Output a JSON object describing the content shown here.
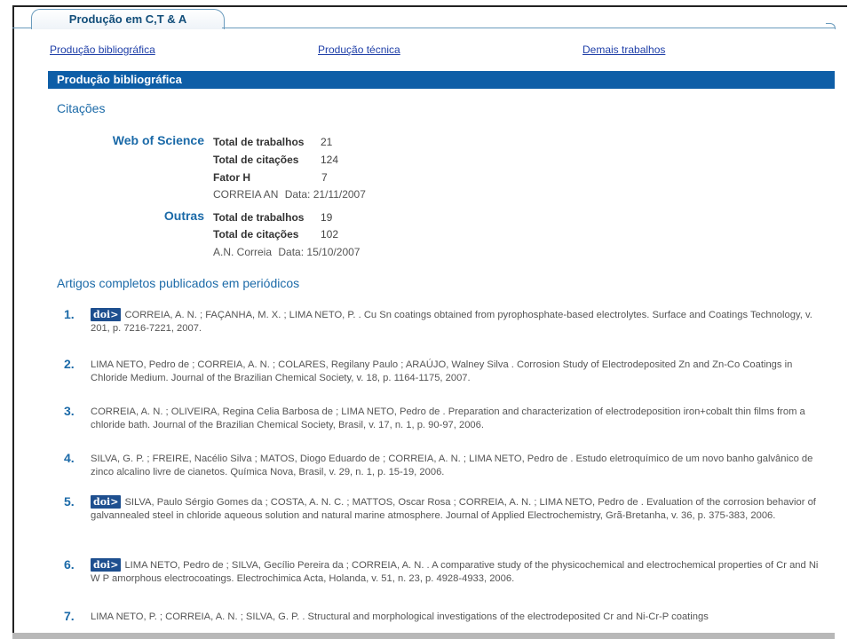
{
  "tab": {
    "label": "Produção em C,T & A"
  },
  "nav": {
    "bibliografica": "Produção bibliográfica",
    "tecnica": "Produção técnica",
    "demais": "Demais trabalhos"
  },
  "section": {
    "title": "Produção bibliográfica"
  },
  "citacoes": {
    "heading": "Citações",
    "wos": {
      "label": "Web of Science",
      "trabalhos_label": "Total de trabalhos",
      "trabalhos_value": "21",
      "citacoes_label": "Total de citações",
      "citacoes_value": "124",
      "fator_label": "Fator H",
      "fator_value": "7",
      "author": "CORREIA AN",
      "date_label": "Data:",
      "date": "21/11/2007"
    },
    "outras": {
      "label": "Outras",
      "trabalhos_label": "Total de trabalhos",
      "trabalhos_value": "19",
      "citacoes_label": "Total de citações",
      "citacoes_value": "102",
      "author": "A.N. Correia",
      "date_label": "Data:",
      "date": "15/10/2007"
    }
  },
  "artigos": {
    "heading": "Artigos completos publicados em periódicos",
    "doi_label": "doi>",
    "items": [
      {
        "num": "1.",
        "doi": true,
        "text": "CORREIA, A. N. ; FAÇANHA, M. X. ; LIMA NETO, P. . Cu Sn coatings obtained from pyrophosphate-based electrolytes. Surface and Coatings Technology, v. 201, p. 7216-7221, 2007."
      },
      {
        "num": "2.",
        "doi": false,
        "text": "LIMA NETO, Pedro de ; CORREIA, A. N. ; COLARES, Regilany Paulo ; ARAÚJO, Walney Silva . Corrosion Study of Electrodeposited Zn and Zn-Co Coatings in Chloride Medium. Journal of the Brazilian Chemical Society, v. 18, p. 1164-1175, 2007."
      },
      {
        "num": "3.",
        "doi": false,
        "text": "CORREIA, A. N. ; OLIVEIRA, Regina Celia Barbosa de ; LIMA NETO, Pedro de . Preparation and characterization of electrodeposition iron+cobalt thin films from a chloride bath. Journal of the Brazilian Chemical Society, Brasil, v. 17, n. 1, p. 90-97, 2006."
      },
      {
        "num": "4.",
        "doi": false,
        "text": "SILVA, G. P. ; FREIRE, Nacélio Silva ; MATOS, Diogo Eduardo de ; CORREIA, A. N. ; LIMA NETO, Pedro de . Estudo eletroquímico de um novo banho galvânico de zinco alcalino livre de cianetos. Química Nova, Brasil, v. 29, n. 1, p. 15-19, 2006."
      },
      {
        "num": "5.",
        "doi": true,
        "text": "SILVA, Paulo Sérgio Gomes da ; COSTA, A. N. C. ; MATTOS, Oscar Rosa ; CORREIA, A. N. ; LIMA NETO, Pedro de . Evaluation of the corrosion behavior of galvannealed steel in chloride aqueous solution and natural marine atmosphere. Journal of Applied Electrochemistry, Grã-Bretanha, v. 36, p. 375-383, 2006."
      },
      {
        "num": "6.",
        "doi": true,
        "text": "LIMA NETO, Pedro de ; SILVA, Gecílio Pereira da ; CORREIA, A. N. . A comparative study of the physicochemical and electrochemical properties of Cr and Ni W P amorphous electrocoatings. Electrochimica Acta, Holanda, v. 51, n. 23, p. 4928-4933, 2006."
      },
      {
        "num": "7.",
        "doi": false,
        "text": "LIMA NETO, P. ; CORREIA, A. N. ; SILVA, G. P. . Structural and morphological investigations of the electrodeposited Cr and Ni-Cr-P coatings"
      }
    ]
  }
}
